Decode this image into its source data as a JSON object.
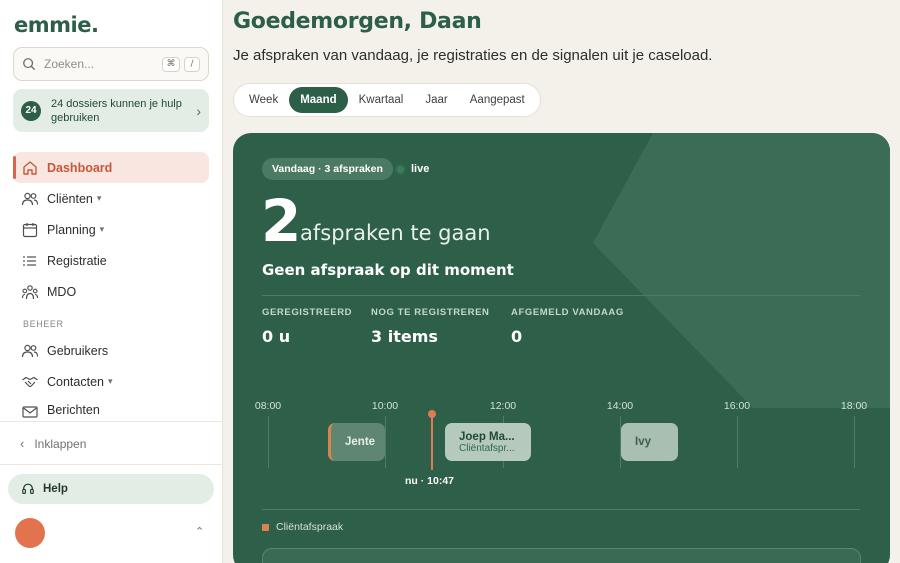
{
  "brand": {
    "logo": "emmie."
  },
  "search": {
    "placeholder": "Zoeken...",
    "shortcut_1": "⌘",
    "shortcut_2": "/"
  },
  "notice": {
    "count": "24",
    "text": "24 dossiers kunnen je hulp gebruiken"
  },
  "nav": {
    "items": [
      {
        "label": "Dashboard",
        "icon": "home-icon"
      },
      {
        "label": "Cliënten",
        "icon": "users-icon"
      },
      {
        "label": "Planning",
        "icon": "calendar-icon"
      },
      {
        "label": "Registratie",
        "icon": "list-icon"
      },
      {
        "label": "MDO",
        "icon": "group-icon"
      }
    ],
    "section_label": "BEHEER",
    "admin_items": [
      {
        "label": "Gebruikers",
        "icon": "users-icon"
      },
      {
        "label": "Contacten",
        "icon": "handshake-icon"
      },
      {
        "label": "Berichten",
        "icon": "mail-icon"
      }
    ]
  },
  "collapse_label": "Inklappen",
  "help_label": "Help",
  "header": {
    "greeting": "Goedemorgen, Daan",
    "subtitle": "Je afspraken van vandaag, je registraties en de signalen uit je caseload."
  },
  "tabs": [
    {
      "label": "Week"
    },
    {
      "label": "Maand",
      "active": true
    },
    {
      "label": "Kwartaal"
    },
    {
      "label": "Jaar"
    },
    {
      "label": "Aangepast"
    }
  ],
  "today": {
    "pill": "Vandaag · 3 afspraken",
    "live": "live",
    "count": "2",
    "count_label": "afspraken te gaan",
    "status": "Geen afspraak op dit moment",
    "stats": [
      {
        "label": "GEREGISTREERD",
        "value": "0 u"
      },
      {
        "label": "NOG TE REGISTREREN",
        "value": "3 items"
      },
      {
        "label": "AFGEMELD VANDAAG",
        "value": "0"
      }
    ],
    "timeline": {
      "ticks": [
        "08:00",
        "10:00",
        "12:00",
        "14:00",
        "16:00",
        "18:00"
      ],
      "events": [
        {
          "title": "Jente",
          "sub": ""
        },
        {
          "title": "Joep Ma...",
          "sub": "Cliëntafspr..."
        },
        {
          "title": "Ivy",
          "sub": ""
        }
      ],
      "now_label": "nu · 10:47",
      "now_time": "10:47"
    },
    "legend": "Cliëntafspraak"
  },
  "colors": {
    "brand": "#2c5e48",
    "card": "#2e5f49",
    "accent": "#e07a57",
    "active_nav_bg": "#f9e6e0"
  }
}
